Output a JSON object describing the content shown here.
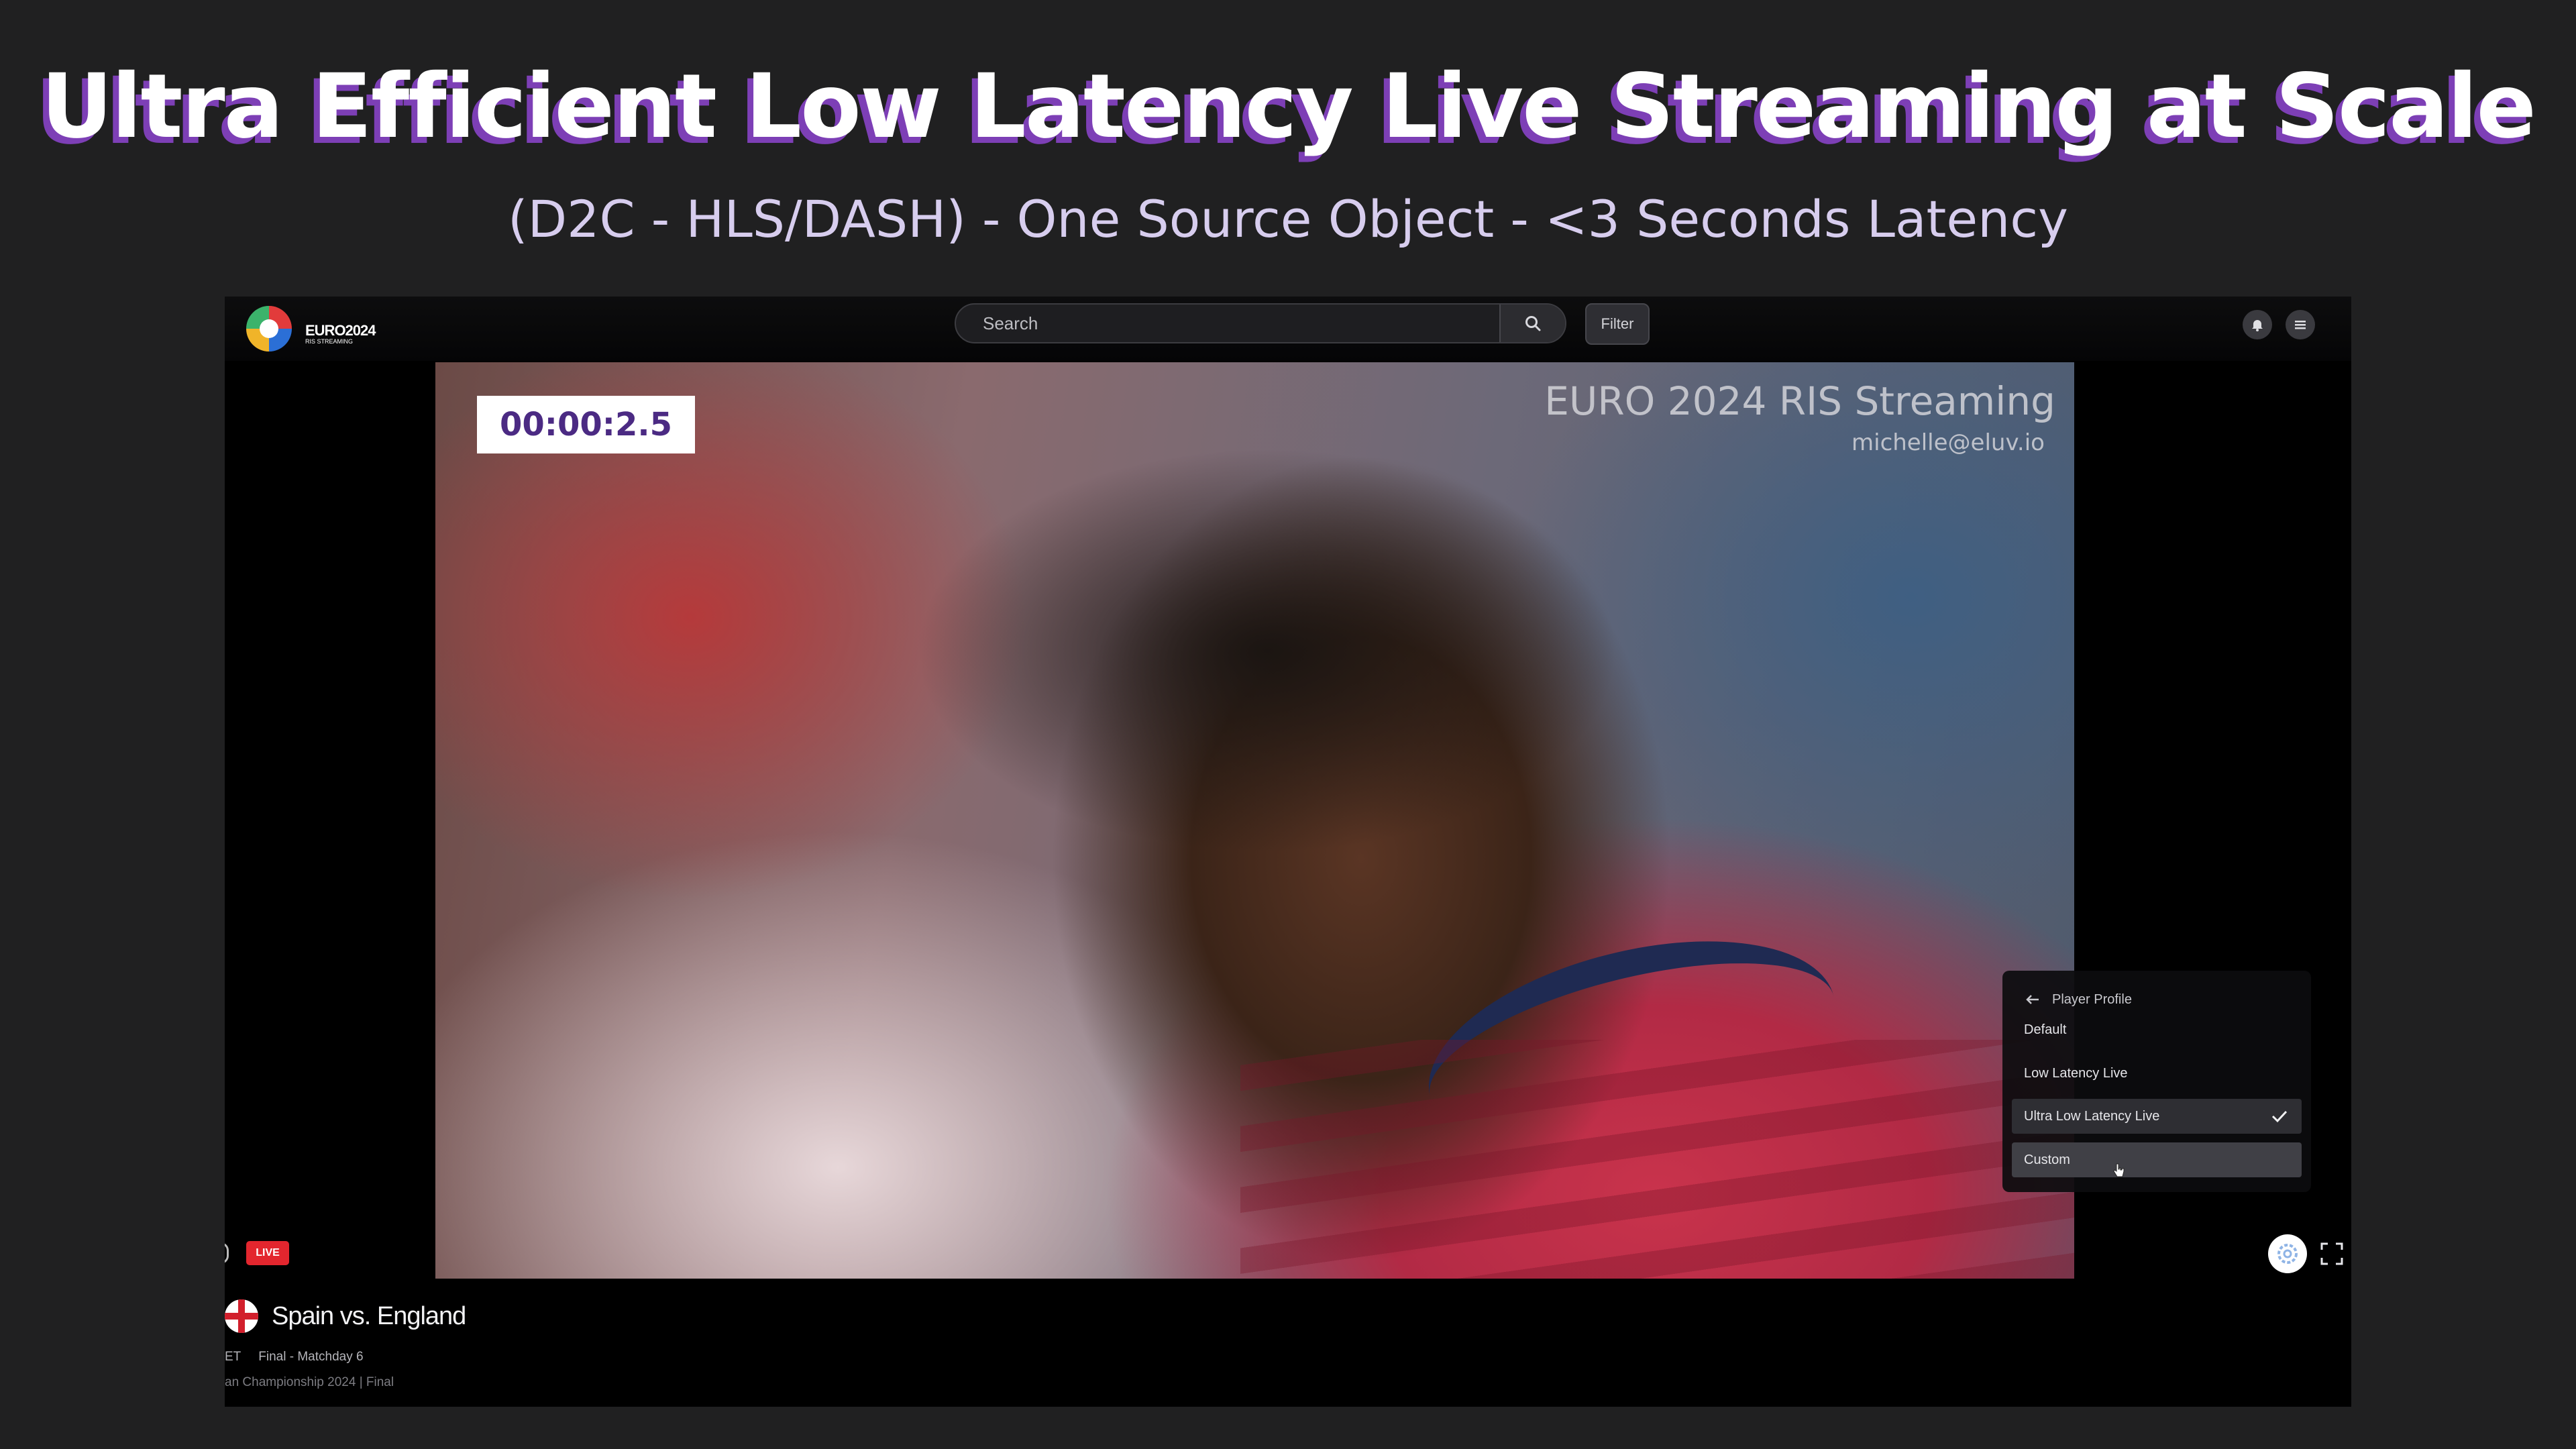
{
  "slide": {
    "headline": "Ultra Efficient  Low Latency Live Streaming at Scale",
    "subheadline": "(D2C - HLS/DASH) - One Source Object - <3 Seconds Latency",
    "colors": {
      "background": "#202021",
      "headline_shadow": "#7d3fb6",
      "subheadline": "#d7cdee"
    }
  },
  "app": {
    "logo": {
      "wordmark": "EURO2024",
      "tagline": "RIS STREAMING",
      "icon": "euro2024-logo"
    },
    "search": {
      "placeholder": "Search",
      "value": "",
      "icon": "search-icon"
    },
    "filter_label": "Filter",
    "top_icons": [
      "bell-icon",
      "menu-icon"
    ],
    "video": {
      "timer": "00:00:2.5",
      "watermark_title": "EURO 2024 RIS Streaming",
      "watermark_user": "michelle@eluv.io"
    },
    "player_profile_menu": {
      "header": "Player Profile",
      "items": [
        {
          "label": "Default",
          "selected": false
        },
        {
          "label": "Low Latency Live",
          "selected": false
        },
        {
          "label": "Ultra Low Latency Live",
          "selected": true
        },
        {
          "label": "Custom",
          "selected": false,
          "hovered": true
        }
      ]
    },
    "controls": {
      "live_badge": "LIVE",
      "settings_icon": "gear-icon",
      "fullscreen_icon": "fullscreen-icon"
    },
    "match": {
      "title": "Spain vs. England",
      "meta_time": "ET",
      "meta_round": "Final - Matchday 6",
      "meta_competition": "an Championship 2024 | Final"
    },
    "colors": {
      "accent_live": "#e3262e",
      "timer_text": "#4b2a83"
    }
  }
}
